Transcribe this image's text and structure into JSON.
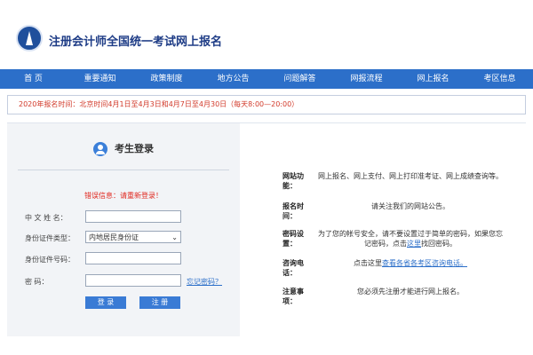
{
  "header": {
    "title": "注册会计师全国统一考试网上报名"
  },
  "nav": {
    "items": [
      "首 页",
      "重要通知",
      "政策制度",
      "地方公告",
      "问题解答",
      "网报流程",
      "网上报名",
      "考区信息"
    ]
  },
  "notice": {
    "text": "2020年报名时间：北京时间4月1日至4月3日和4月7日至4月30日（每天8:00—20:00）"
  },
  "login": {
    "title": "考生登录",
    "error": "错误信息：请重新登录！",
    "name_label": "中 文 姓 名：",
    "id_type_label": "身份证件类型：",
    "id_type_value": "内地居民身份证",
    "id_number_label": "身份证件号码：",
    "password_label": "密         码：",
    "forgot_link": "忘记密码？",
    "login_button": "登 录",
    "register_button": "注 册"
  },
  "info": {
    "rows": [
      {
        "key": "网站功能：",
        "value": "网上报名、网上支付、网上打印准考证、网上成绩查询等。"
      },
      {
        "key": "报名时间：",
        "value": "请关注我们的网站公告。"
      },
      {
        "key": "密码设置：",
        "value_pre": "为了您的帐号安全，请不要设置过于简单的密码，如果您忘记密码，点击",
        "value_link": "这里",
        "value_post": "找回密码。"
      },
      {
        "key": "咨询电话：",
        "value_pre": "点击这里",
        "value_link": "查看各省各考区咨询电话。"
      },
      {
        "key": "注意事项：",
        "value": "您必须先注册才能进行网上报名。"
      }
    ]
  },
  "colors": {
    "nav": "#2c6fc9",
    "title": "#1e3c86",
    "error": "#e0281f",
    "button": "#3a7bd5"
  }
}
